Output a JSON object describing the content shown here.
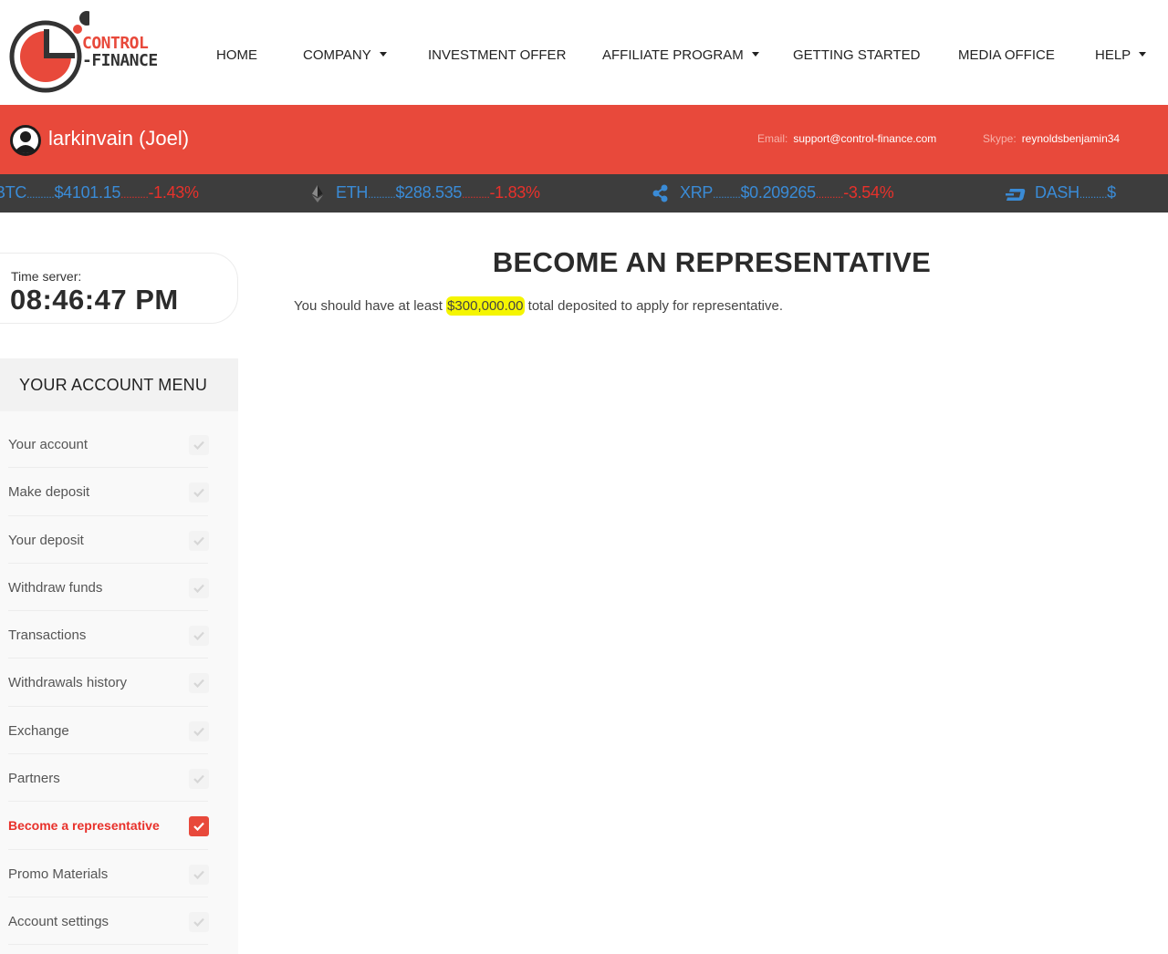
{
  "logo": {
    "line1": "CONTROL",
    "line2": "-FINANCE"
  },
  "nav": {
    "items": [
      {
        "label": "HOME",
        "has_dropdown": false
      },
      {
        "label": "COMPANY",
        "has_dropdown": true
      },
      {
        "label": "INVESTMENT OFFER",
        "has_dropdown": false
      },
      {
        "label": "AFFILIATE PROGRAM",
        "has_dropdown": true
      },
      {
        "label": "GETTING STARTED",
        "has_dropdown": false
      },
      {
        "label": "MEDIA OFFICE",
        "has_dropdown": false
      },
      {
        "label": "HELP",
        "has_dropdown": true
      }
    ]
  },
  "user": {
    "login": "larkinvain",
    "name": "(Joel)"
  },
  "contacts": {
    "email_label": "Email:",
    "email": "support@control-finance.com",
    "skype_label": "Skype:",
    "skype": "reynoldsbenjamin34"
  },
  "ticker": [
    {
      "symbol": "BTC",
      "dots": "..........",
      "price": "$4101.15",
      "dots2": "..........",
      "change": "-1.43%",
      "icon": "bitcoin-icon"
    },
    {
      "symbol": "ETH",
      "dots": "..........",
      "price": "$288.535",
      "dots2": "..........",
      "change": "-1.83%",
      "icon": "ethereum-icon"
    },
    {
      "symbol": "XRP",
      "dots": "..........",
      "price": "$0.209265",
      "dots2": "..........",
      "change": "-3.54%",
      "icon": "ripple-icon"
    },
    {
      "symbol": "DASH",
      "dots": "..........",
      "price": "$",
      "dots2": "",
      "change": "",
      "icon": "dash-icon"
    }
  ],
  "time_server": {
    "label": "Time server:",
    "value": "08:46:47 PM"
  },
  "account_menu": {
    "title": "YOUR ACCOUNT MENU",
    "items": [
      {
        "label": "Your account",
        "active": false
      },
      {
        "label": "Make deposit",
        "active": false
      },
      {
        "label": "Your deposit",
        "active": false
      },
      {
        "label": "Withdraw funds",
        "active": false
      },
      {
        "label": "Transactions",
        "active": false
      },
      {
        "label": "Withdrawals history",
        "active": false
      },
      {
        "label": "Exchange",
        "active": false
      },
      {
        "label": "Partners",
        "active": false
      },
      {
        "label": "Become a representative",
        "active": true
      },
      {
        "label": "Promo Materials",
        "active": false
      },
      {
        "label": "Account settings",
        "active": false
      }
    ]
  },
  "main": {
    "title": "BECOME AN REPRESENTATIVE",
    "text_before": "You should have at least ",
    "amount": "$300,000.00",
    "text_after": " total deposited to apply for representative."
  },
  "colors": {
    "brand_red": "#e8493b",
    "ticker_bg": "#3d3d3d",
    "ticker_blue": "#3a8bd6",
    "negative_red": "#e8312b",
    "highlight": "#f5f500"
  }
}
